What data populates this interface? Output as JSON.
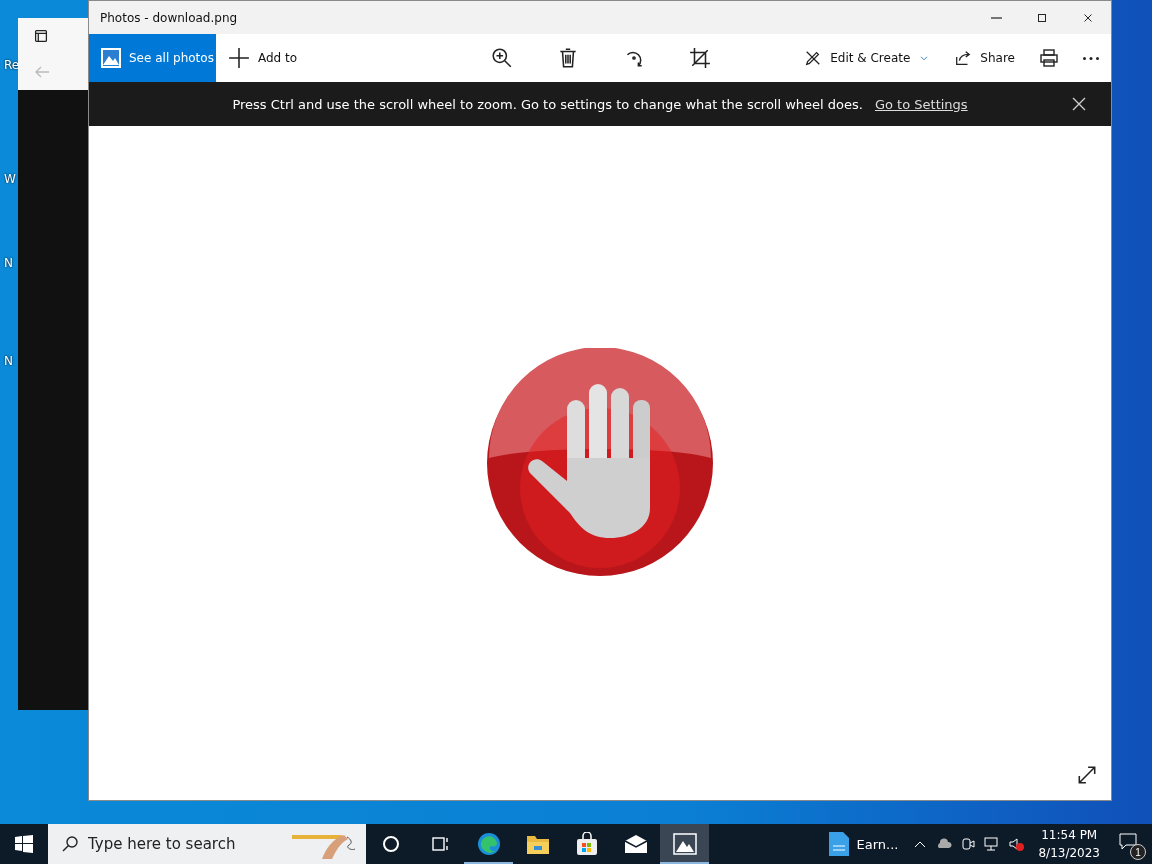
{
  "desktop_icons": [
    {
      "label": "Re"
    },
    {
      "label": "W"
    },
    {
      "label": "N"
    },
    {
      "label": "N"
    }
  ],
  "photos": {
    "title": "Photos - download.png",
    "see_all": "See all photos",
    "add_to": "Add to",
    "edit_create": "Edit & Create",
    "share": "Share",
    "notice": "Press Ctrl and use the scroll wheel to zoom. Go to settings to change what the scroll wheel does.",
    "notice_link": "Go to Settings"
  },
  "taskbar": {
    "search_placeholder": "Type here to search",
    "apps": [
      {
        "kind": "taskview",
        "running": false,
        "selected": false
      },
      {
        "kind": "taskview2",
        "running": false,
        "selected": false
      },
      {
        "kind": "edge",
        "running": true,
        "selected": false
      },
      {
        "kind": "explorer",
        "running": false,
        "selected": false
      },
      {
        "kind": "store",
        "running": false,
        "selected": false
      },
      {
        "kind": "mail",
        "running": false,
        "selected": false
      },
      {
        "kind": "photos",
        "running": true,
        "selected": true
      }
    ],
    "pinned_label": "Earn...",
    "time": "11:54 PM",
    "date": "8/13/2023",
    "notifications": "1"
  }
}
